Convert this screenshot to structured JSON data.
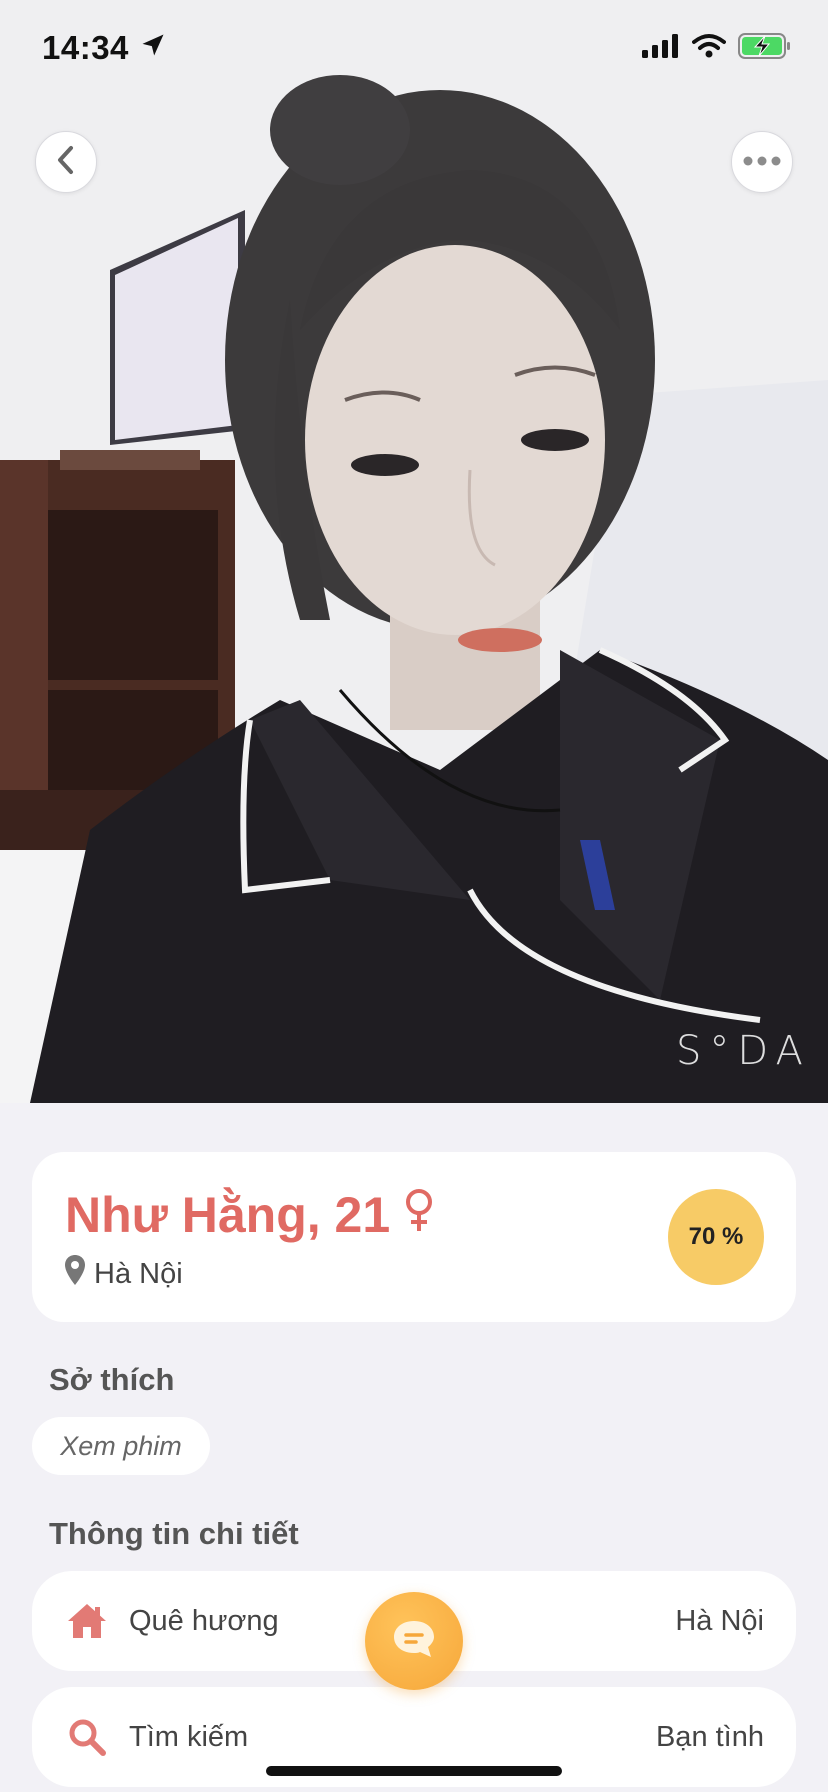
{
  "status_bar": {
    "time": "14:34",
    "icons": [
      "location-arrow-icon",
      "cellular-signal-icon",
      "wifi-icon",
      "battery-charging-icon"
    ]
  },
  "photo": {
    "watermark": "S°DA"
  },
  "profile": {
    "name_age": "Như Hằng, 21",
    "gender_icon": "female-icon",
    "location": "Hà Nội",
    "match_percent": "70 %"
  },
  "interests": {
    "title": "Sở thích",
    "items": [
      "Xem phim"
    ]
  },
  "details": {
    "title": "Thông tin chi tiết",
    "rows": [
      {
        "icon": "home-icon",
        "label": "Quê hương",
        "value": "Hà Nội"
      },
      {
        "icon": "search-icon",
        "label": "Tìm kiếm",
        "value": "Bạn tình"
      }
    ]
  },
  "colors": {
    "accent_name": "#e06a63",
    "match_badge": "#f7cb66",
    "chat_button": "#f6a73a",
    "background": "#f2f1f6"
  }
}
